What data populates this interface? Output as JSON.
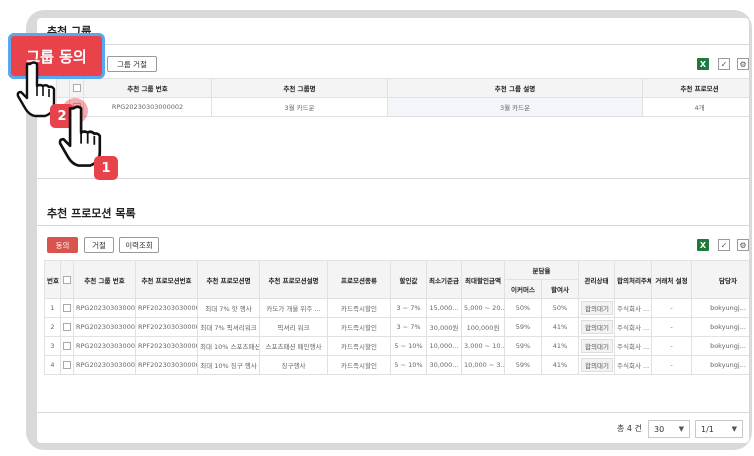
{
  "section1": {
    "title": "추천 그룹",
    "reject_button": "그룹 거절",
    "columns": [
      "추천 그룹 번호",
      "추천 그룹명",
      "추천 그룹 설명",
      "추천 프로모션"
    ],
    "rows": [
      {
        "group_no": "RPG20230303000002",
        "group_name": "3월 카드운",
        "group_desc": "3월 카드운",
        "promo_count": "4개"
      }
    ]
  },
  "callout": {
    "label": "그룹 동의"
  },
  "steps": {
    "one": "1",
    "two": "2"
  },
  "section2": {
    "title": "추천 프로모션 목록",
    "buttons": {
      "agree": "동의",
      "reject": "거절",
      "history": "이력조회"
    },
    "headers": {
      "no": "번호",
      "group_no": "추천 그룹 번호",
      "promo_no": "추천 프로모션번호",
      "promo_name": "추천 프로모션명",
      "promo_desc": "추천 프로모션설명",
      "promo_type": "프로모션종류",
      "discount": "할인값",
      "min_amt": "최소기준금",
      "max_amt": "최대할인금액",
      "share": "분담율",
      "ecommerce": "이커머스",
      "merchant": "할여사",
      "status": "관리상태",
      "agree_org": "합의처리주체",
      "partner": "거래처 설정",
      "manager": "담당자"
    },
    "rows": [
      {
        "no": "1",
        "group_no": "RPG20230303000002",
        "promo_no": "RPF20230303000002",
        "name": "최대 7% 핫 행사",
        "desc": "카도가 개울 위주 ...",
        "type": "카드즉시할인",
        "discount": "3 ~ 7%",
        "min": "15,000...",
        "max": "5,000 ~ 20...",
        "ecom": "50%",
        "merch": "50%",
        "status": "합의대기",
        "org": "주식회사 ...",
        "partner": "-",
        "manager": "bokyungj..."
      },
      {
        "no": "2",
        "group_no": "RPG20230303000002",
        "promo_no": "RPF20230303000003",
        "name": "최대 7% 픽셔리워크",
        "desc": "픽셔리 워크",
        "type": "카드즉시할인",
        "discount": "3 ~ 7%",
        "min": "30,000원",
        "max": "100,000원",
        "ecom": "59%",
        "merch": "41%",
        "status": "합의대기",
        "org": "주식회사 ...",
        "partner": "-",
        "manager": "bokyungj..."
      },
      {
        "no": "3",
        "group_no": "RPG20230303000002",
        "promo_no": "RPF20230303000004",
        "name": "최대 10% 스포츠패션",
        "desc": "스포츠패션 페인행사",
        "type": "카드즉시할인",
        "discount": "5 ~ 10%",
        "min": "10,000...",
        "max": "3,000 ~ 10...",
        "ecom": "59%",
        "merch": "41%",
        "status": "합의대기",
        "org": "주식회사 ...",
        "partner": "-",
        "manager": "bokyungj..."
      },
      {
        "no": "4",
        "group_no": "RPG20230303000002",
        "promo_no": "RPF20230303000005",
        "name": "최대 10% 징구 행사",
        "desc": "징구행사",
        "type": "카드즉시할인",
        "discount": "5 ~ 10%",
        "min": "30,000...",
        "max": "10,000 ~ 3...",
        "ecom": "59%",
        "merch": "41%",
        "status": "합의대기",
        "org": "주식회사 ...",
        "partner": "-",
        "manager": "bokyungj..."
      }
    ]
  },
  "pager": {
    "total": "총 4 건",
    "page_size": "30",
    "page": "1/1"
  },
  "icons": {
    "excel": "excel-icon",
    "edit": "edit-icon",
    "settings": "settings-icon"
  },
  "colors": {
    "accent_red": "#e8434b",
    "callout_border": "#5aa6f0",
    "excel_green": "#1d7a3a"
  }
}
